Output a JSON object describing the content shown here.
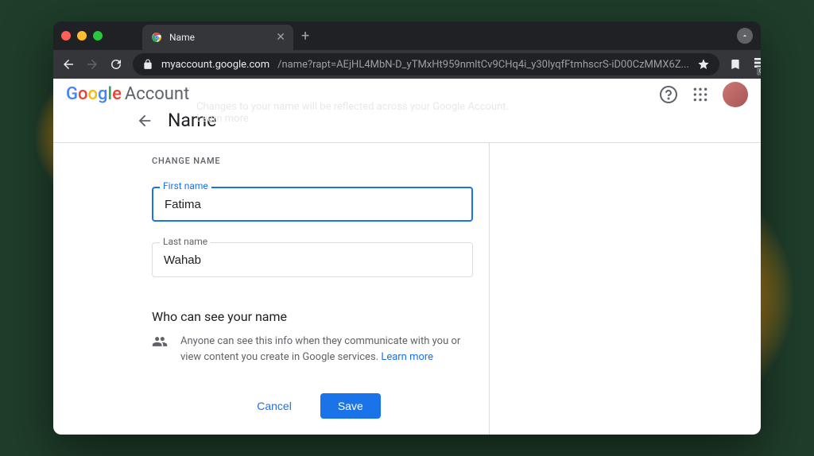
{
  "browser": {
    "tab_title": "Name",
    "url_domain": "myaccount.google.com",
    "url_path": "/name?rapt=AEjHL4MbN-D_yTMxHt959nmltCv9CHq4i_y30lyqfFtmhscrS-iD00CzMMX6Z...",
    "ext_badge": "Off"
  },
  "header": {
    "account_label": "Account"
  },
  "page": {
    "ghost_text": "Changes to your name will be reflected across your Google Account. Learn more",
    "title": "Name",
    "section_label": "CHANGE NAME",
    "first_name_label": "First name",
    "first_name_value": "Fatima",
    "last_name_label": "Last name",
    "last_name_value": "Wahab",
    "privacy_title": "Who can see your name",
    "privacy_text": "Anyone can see this info when they communicate with you or view content you create in Google services. ",
    "privacy_link": "Learn more",
    "cancel_label": "Cancel",
    "save_label": "Save"
  }
}
